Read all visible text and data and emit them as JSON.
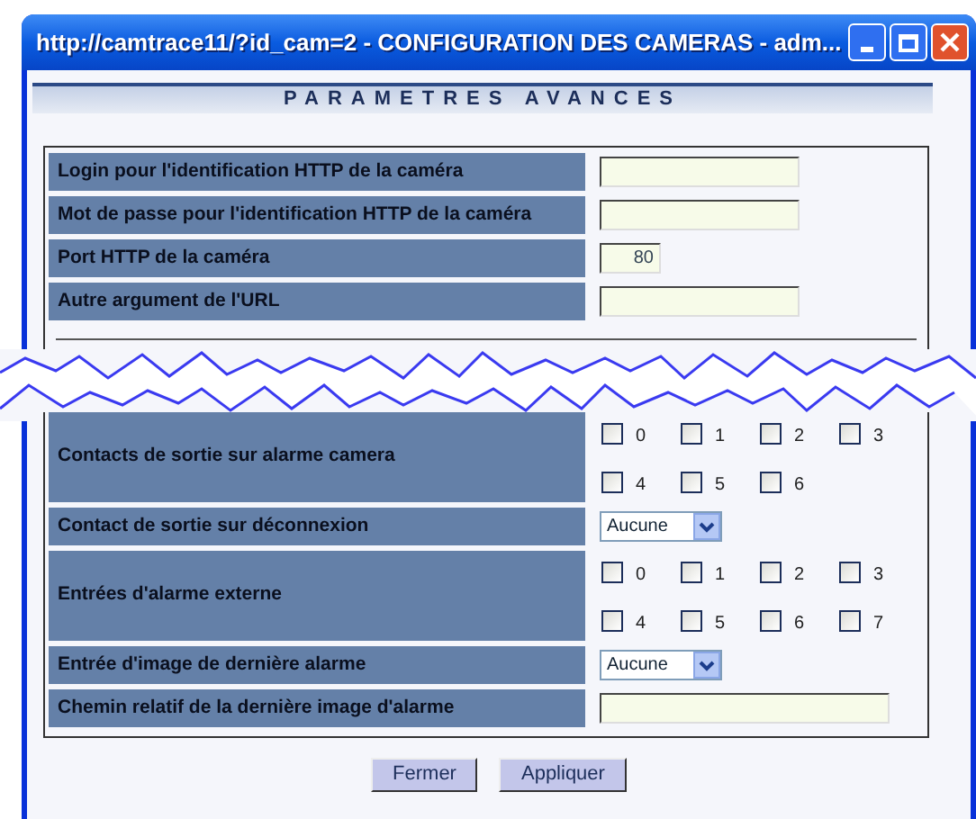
{
  "window": {
    "title": "http://camtrace11/?id_cam=2 - CONFIGURATION DES CAMERAS - adm..."
  },
  "header": "PARAMETRES AVANCES",
  "sections": [
    {
      "rows": [
        {
          "kind": "text",
          "label": "Login pour l'identification HTTP de la caméra",
          "value": ""
        },
        {
          "kind": "text",
          "label": "Mot de passe pour l'identification HTTP de la caméra",
          "value": ""
        },
        {
          "kind": "number",
          "label": "Port HTTP de la caméra",
          "value": "80"
        },
        {
          "kind": "text",
          "label": "Autre argument de l'URL",
          "value": ""
        }
      ]
    },
    {
      "rows": [
        {
          "kind": "checkboxes",
          "label": "Contacts de sortie sur alarme camera",
          "options": [
            {
              "label": "0",
              "checked": false
            },
            {
              "label": "1",
              "checked": false
            },
            {
              "label": "2",
              "checked": false
            },
            {
              "label": "3",
              "checked": false
            },
            {
              "label": "4",
              "checked": false
            },
            {
              "label": "5",
              "checked": false
            },
            {
              "label": "6",
              "checked": false
            }
          ]
        },
        {
          "kind": "select",
          "label": "Contact de sortie sur déconnexion",
          "value": "Aucune"
        },
        {
          "kind": "checkboxes",
          "label": "Entrées d'alarme externe",
          "options": [
            {
              "label": "0",
              "checked": false
            },
            {
              "label": "1",
              "checked": false
            },
            {
              "label": "2",
              "checked": false
            },
            {
              "label": "3",
              "checked": false
            },
            {
              "label": "4",
              "checked": false
            },
            {
              "label": "5",
              "checked": false
            },
            {
              "label": "6",
              "checked": false
            },
            {
              "label": "7",
              "checked": false
            }
          ]
        },
        {
          "kind": "select",
          "label": "Entrée d'image de dernière alarme",
          "value": "Aucune"
        },
        {
          "kind": "path",
          "label": "Chemin relatif de la dernière image d'alarme",
          "value": ""
        }
      ]
    }
  ],
  "buttons": [
    "Fermer",
    "Appliquer"
  ]
}
